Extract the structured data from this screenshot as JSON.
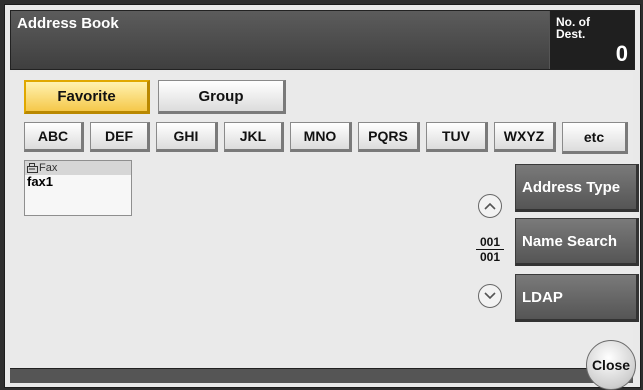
{
  "header": {
    "title": "Address Book",
    "dest_label": "No. of Dest.",
    "dest_count": "0"
  },
  "tabs": [
    {
      "label": "Favorite",
      "selected": true
    },
    {
      "label": "Group",
      "selected": false
    }
  ],
  "index_buttons": [
    "ABC",
    "DEF",
    "GHI",
    "JKL",
    "MNO",
    "PQRS",
    "TUV",
    "WXYZ",
    "etc"
  ],
  "entries": [
    {
      "type": "Fax",
      "name": "fax1",
      "icon": "fax-icon"
    }
  ],
  "pager": {
    "current": "001",
    "total": "001"
  },
  "side_buttons": {
    "address_type": "Address Type",
    "name_search": "Name Search",
    "ldap": "LDAP"
  },
  "close_label": "Close",
  "colors": {
    "header_bg": "#4a4a4a",
    "selected_tab": "#f5c84a",
    "side_button": "#666666"
  }
}
